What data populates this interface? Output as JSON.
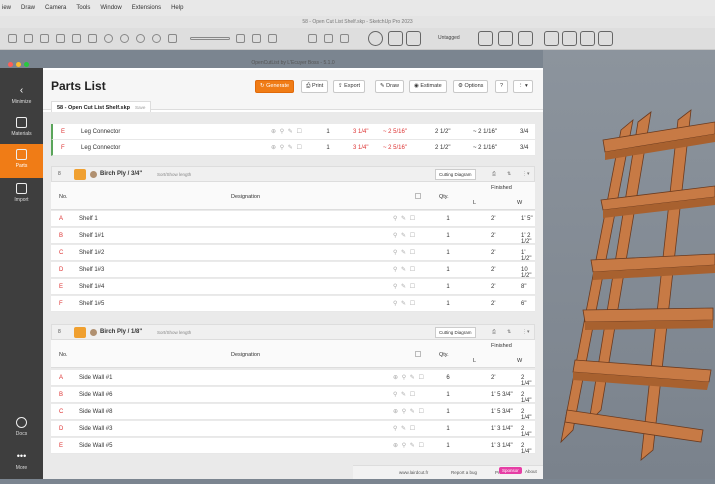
{
  "menubar": [
    "iew",
    "Draw",
    "Camera",
    "Tools",
    "Window",
    "Extensions",
    "Help"
  ],
  "app_title": "58 - Open Cut List Shelf.skp - SketchUp Pro 2023",
  "toolbar": {
    "entity_label": "Untagged"
  },
  "window_title": "OpenCutList by L'Ecuyer Boss - 5.1.0",
  "sidebar": [
    {
      "label": "Minimize"
    },
    {
      "label": "Materials"
    },
    {
      "label": "Parts"
    },
    {
      "label": "Import"
    },
    {
      "label": "Docs"
    },
    {
      "label": "More"
    }
  ],
  "header": {
    "title": "Parts List",
    "buttons": [
      "Generate",
      "Print",
      "Export",
      "Draw",
      "Estimate",
      "Options"
    ],
    "tab": "58 - Open Cut List Shelf.skp",
    "tab_sub": "Save"
  },
  "top_rows": [
    {
      "id": "E",
      "name": "Leg Connector",
      "qty": "1",
      "a1": "3 1/4\"",
      "a2": "~ 2 5/16\"",
      "a3": "2 1/2\"",
      "a4": "~ 2 1/16\"",
      "a5": "3/4"
    },
    {
      "id": "F",
      "name": "Leg Connector",
      "qty": "1",
      "a1": "3 1/4\"",
      "a2": "~ 2 5/16\"",
      "a3": "2 1/2\"",
      "a4": "~ 2 1/16\"",
      "a5": "3/4"
    }
  ],
  "group1": {
    "count": "8",
    "name": "Birch Ply / 3/4\"",
    "option": "Sort/Show length",
    "cutting_btn": "Cutting Diagram",
    "headers": {
      "no": "No.",
      "designation": "Designation",
      "qty": "Qty.",
      "finished": "Finished",
      "L": "L",
      "W": "W"
    },
    "rows": [
      {
        "id": "A",
        "name": "Shelf 1",
        "qty": "1",
        "L": "2'",
        "W": "1' 5\""
      },
      {
        "id": "B",
        "name": "Shelf 1#1",
        "qty": "1",
        "L": "2'",
        "W": "1' 2 1/2\""
      },
      {
        "id": "C",
        "name": "Shelf 1#2",
        "qty": "1",
        "L": "2'",
        "W": "1' 1/2\""
      },
      {
        "id": "D",
        "name": "Shelf 1#3",
        "qty": "1",
        "L": "2'",
        "W": "10 1/2\""
      },
      {
        "id": "E",
        "name": "Shelf 1#4",
        "qty": "1",
        "L": "2'",
        "W": "8\""
      },
      {
        "id": "F",
        "name": "Shelf 1#5",
        "qty": "1",
        "L": "2'",
        "W": "6\""
      }
    ]
  },
  "group2": {
    "count": "8",
    "name": "Birch Ply / 1/8\"",
    "option": "Sort/Show length",
    "cutting_btn": "Cutting Diagram",
    "headers": {
      "no": "No.",
      "designation": "Designation",
      "qty": "Qty.",
      "finished": "Finished",
      "L": "L",
      "W": "W"
    },
    "rows": [
      {
        "id": "A",
        "name": "Side Wall #1",
        "qty": "6",
        "L": "2'",
        "W": "2 1/4\""
      },
      {
        "id": "B",
        "name": "Side Wall #6",
        "qty": "1",
        "L": "1' 5 3/4\"",
        "W": "2 1/4\""
      },
      {
        "id": "C",
        "name": "Side Wall #8",
        "qty": "1",
        "L": "1' 5 3/4\"",
        "W": "2 1/4\""
      },
      {
        "id": "D",
        "name": "Side Wall #3",
        "qty": "1",
        "L": "1' 3 1/4\"",
        "W": "2 1/4\""
      },
      {
        "id": "E",
        "name": "Side Wall #5",
        "qty": "1",
        "L": "1' 3 1/4\"",
        "W": "2 1/4\""
      }
    ]
  },
  "footer": {
    "site": "www.lairdcut.fr",
    "report": "Report a bug",
    "prefs": "Preferences",
    "sponsor": "Sponsor",
    "about": "About"
  }
}
